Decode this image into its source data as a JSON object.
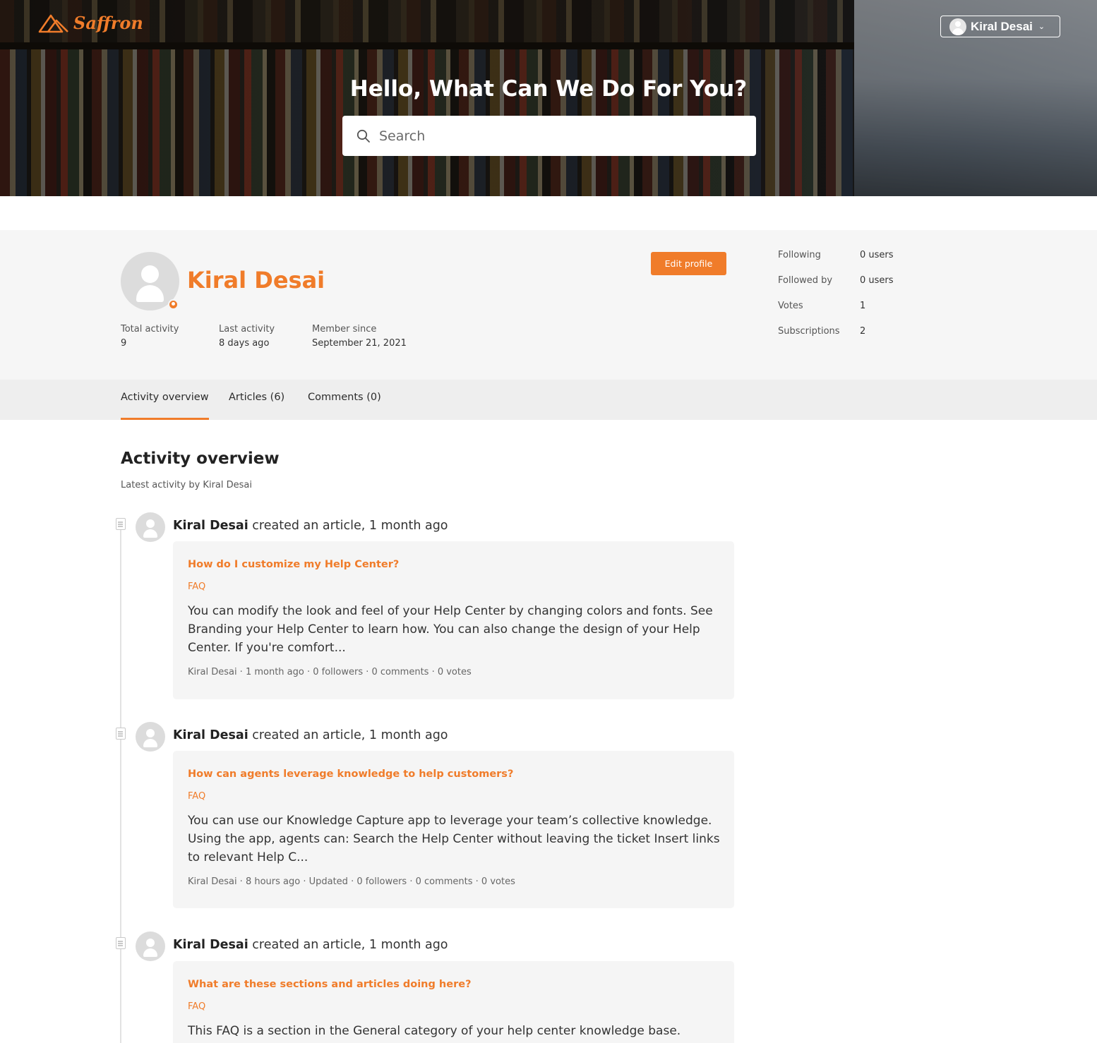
{
  "header": {
    "logo_text": "Saffron",
    "user_name": "Kiral Desai",
    "hero_title": "Hello, What Can We Do For You?",
    "search_placeholder": "Search"
  },
  "profile": {
    "name": "Kiral Desai",
    "edit_label": "Edit profile",
    "stats": [
      {
        "label": "Total activity",
        "value": "9"
      },
      {
        "label": "Last activity",
        "value": "8 days ago"
      },
      {
        "label": "Member since",
        "value": "September 21, 2021"
      }
    ],
    "side_stats": [
      {
        "label": "Following",
        "value": "0 users"
      },
      {
        "label": "Followed by",
        "value": "0 users"
      },
      {
        "label": "Votes",
        "value": "1"
      },
      {
        "label": "Subscriptions",
        "value": "2"
      }
    ]
  },
  "tabs": [
    {
      "label": "Activity overview",
      "active": true
    },
    {
      "label": "Articles (6)",
      "active": false
    },
    {
      "label": "Comments (0)",
      "active": false
    }
  ],
  "activity": {
    "title": "Activity overview",
    "subtitle": "Latest activity by Kiral Desai",
    "entries": [
      {
        "author": "Kiral Desai",
        "action": "created an article, 1 month ago",
        "title": "How do I customize my Help Center?",
        "category": "FAQ",
        "body": "You can modify the look and feel of your Help Center by changing colors and fonts. See Branding your Help Center to learn how. You can also change the design of your Help Center. If you're comfort...",
        "meta": "Kiral Desai · 1 month ago · 0 followers · 0 comments · 0 votes"
      },
      {
        "author": "Kiral Desai",
        "action": "created an article, 1 month ago",
        "title": "How can agents leverage knowledge to help customers?",
        "category": "FAQ",
        "body": "You can use our Knowledge Capture app to leverage your team’s collective knowledge. Using the app, agents can: Search the Help Center without leaving the ticket Insert links to relevant Help C...",
        "meta": "Kiral Desai · 8 hours ago · Updated · 0 followers · 0 comments · 0 votes"
      },
      {
        "author": "Kiral Desai",
        "action": "created an article, 1 month ago",
        "title": "What are these sections and articles doing here?",
        "category": "FAQ",
        "body": "This FAQ is a section in the General category of your help center knowledge base.",
        "meta": ""
      }
    ]
  },
  "colors": {
    "accent": "#f07c2a",
    "band": "#f6f6f6",
    "tabs_bg": "#eeeeee"
  }
}
